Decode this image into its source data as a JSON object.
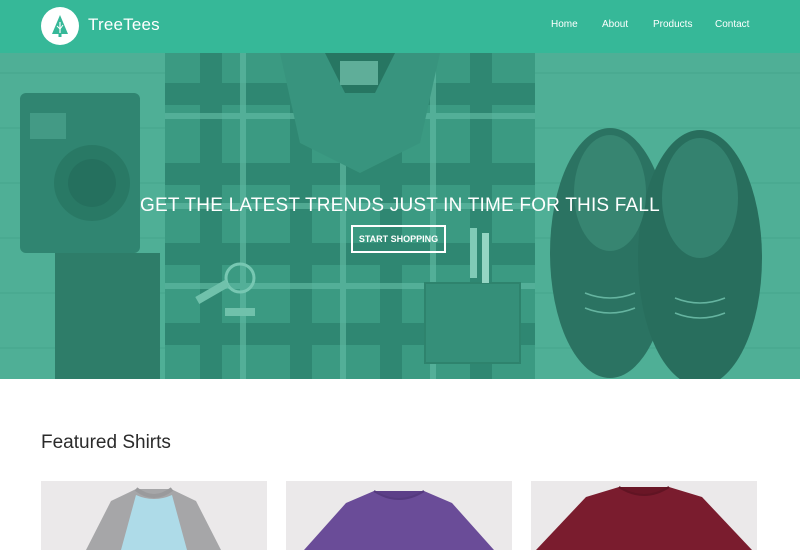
{
  "header": {
    "brand": "TreeTees",
    "logo_icon": "tree-icon",
    "brand_color": "#36b898",
    "nav": [
      {
        "label": "Home"
      },
      {
        "label": "About"
      },
      {
        "label": "Products"
      },
      {
        "label": "Contact"
      }
    ]
  },
  "hero": {
    "title": "GET THE LATEST TRENDS JUST IN TIME FOR THIS FALL",
    "button_label": "START SHOPPING",
    "image_subject": "flat-lay-camera-plaid-shirt-keys-shoes"
  },
  "featured": {
    "title": "Featured Shirts",
    "products": [
      {
        "color_name": "raglan-blue-grey",
        "body_color": "#aedbe8",
        "sleeve_color": "#a6a6a8"
      },
      {
        "color_name": "purple",
        "body_color": "#6a4c98"
      },
      {
        "color_name": "maroon",
        "body_color": "#7a1c2e"
      }
    ]
  }
}
